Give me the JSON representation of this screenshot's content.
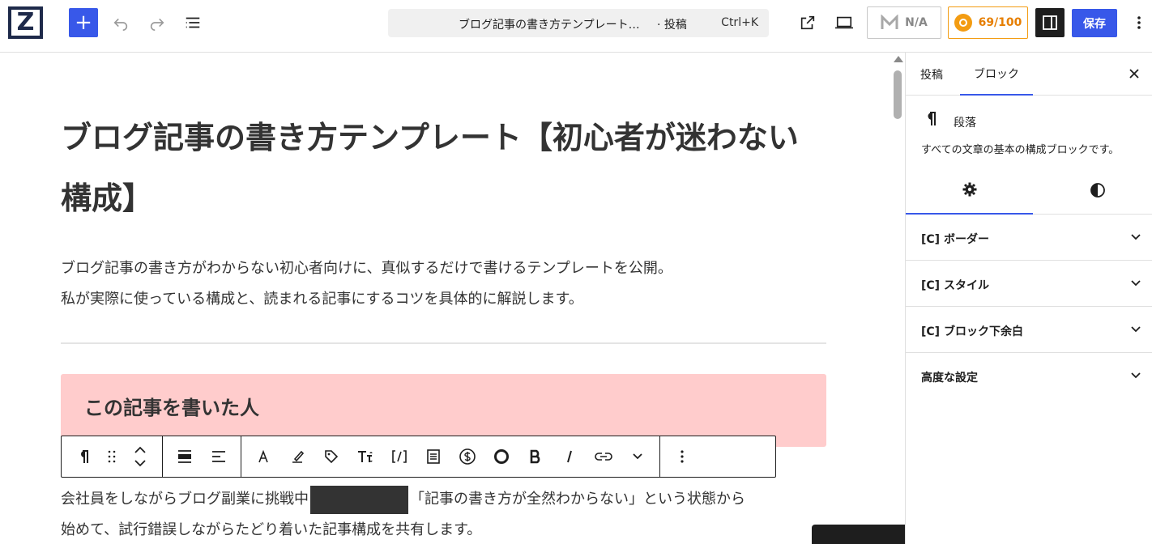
{
  "header": {
    "logo_letter": "Z",
    "add_label": "+",
    "command_title": "ブログ記事の書き方テンプレート…",
    "command_type": "· 投稿",
    "command_shortcut": "Ctrl+K",
    "na_label": "N/A",
    "score_label": "69/100",
    "save_label": "保存"
  },
  "post": {
    "title": "ブログ記事の書き方テンプレート【初心者が迷わない構成】",
    "intro_lines": [
      "ブログ記事の書き方がわからない初心者向けに、真似するだけで書けるテンプレートを公開。",
      "私が実際に使っている構成と、読まれる記事にするコツを具体的に解説します。"
    ],
    "author_heading": "この記事を書いた人",
    "body_before": "会社員をしながらブログ副業に挑戦中",
    "body_after_line1": "「記事の書き方が全然わからない」という状態から",
    "body_line2": "始めて、試行錯誤しながらたどり着いた記事構成を共有します。"
  },
  "toolbar": {
    "groups": [
      [
        "pilcrow-icon",
        "drag-handle-icon",
        "move-up-down-icon"
      ],
      [
        "align-wide-icon",
        "align-left-icon"
      ],
      [
        "font-color-icon",
        "highlight-icon",
        "tag-icon",
        "font-size-icon",
        "shortcode-icon",
        "list-icon",
        "dollar-icon",
        "circle-icon",
        "bold-icon",
        "italic-icon",
        "link-icon",
        "chevron-down-icon"
      ],
      [
        "more-vertical-icon"
      ]
    ]
  },
  "sidebar": {
    "tab_post": "投稿",
    "tab_block": "ブロック",
    "block_name": "段落",
    "block_desc": "すべての文章の基本の構成ブロックです。",
    "panels": [
      {
        "label": "[C] ボーダー"
      },
      {
        "label": "[C] スタイル"
      },
      {
        "label": "[C] ブロック下余白"
      },
      {
        "label": "高度な設定"
      }
    ]
  },
  "colors": {
    "accent": "#3858e9",
    "author_box": "#ffcccc",
    "score": "#f39c12"
  }
}
